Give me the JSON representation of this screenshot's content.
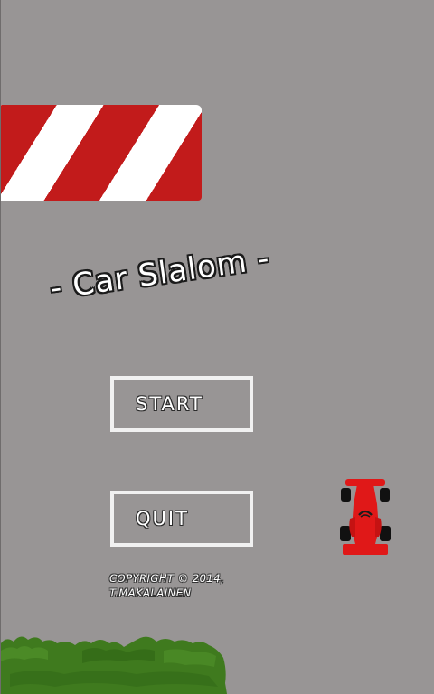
{
  "game": {
    "title": "- Car Slalom -",
    "menu": {
      "start_label": "START",
      "quit_label": "QUIT"
    },
    "copyright_line1": "COPYRIGHT © 2014,",
    "copyright_line2": "T.MAKALAINEN"
  },
  "colors": {
    "road": "#989595",
    "barrier_red": "#c21b1b",
    "barrier_white": "#ffffff",
    "car_red": "#e01818",
    "grass_green": "#3f7a1e"
  },
  "icons": {
    "barrier": "striped-barrier-icon",
    "car": "race-car-icon",
    "grass": "grass-patch-icon"
  }
}
